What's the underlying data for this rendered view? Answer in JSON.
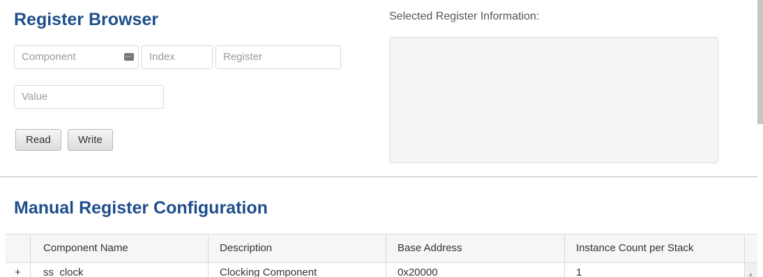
{
  "register_browser": {
    "title": "Register Browser",
    "component_placeholder": "Component",
    "index_placeholder": "Index",
    "register_placeholder": "Register",
    "value_placeholder": "Value",
    "read_label": "Read",
    "write_label": "Write"
  },
  "selected_info": {
    "label": "Selected Register Information:"
  },
  "manual_config": {
    "title": "Manual Register Configuration",
    "columns": [
      "Component Name",
      "Description",
      "Base Address",
      "Instance Count per Stack"
    ],
    "rows": [
      {
        "expand": "+",
        "name": "ss_clock",
        "description": "Clocking Component",
        "base_address": "0x20000",
        "instance_count": "1"
      }
    ]
  },
  "icons": {
    "component_picker": "menu-dots-icon",
    "expand_row": "plus-icon",
    "scroll_up": "triangle-up-icon"
  },
  "colors": {
    "heading": "#1f4e8c"
  }
}
